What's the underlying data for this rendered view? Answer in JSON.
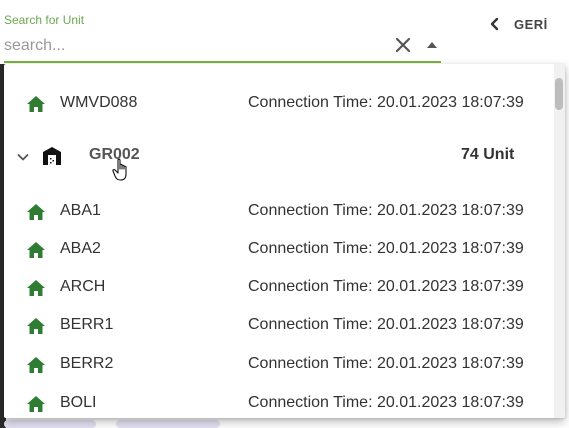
{
  "search": {
    "label": "Search for Unit",
    "placeholder": "search...",
    "value": ""
  },
  "nav": {
    "back_label": "GERİ"
  },
  "colors": {
    "accent": "#7cb342",
    "online_icon": "#2e7d32"
  },
  "icons": {
    "clear": "close-icon",
    "toggle": "triangle-up-icon",
    "back": "chevron-left-icon",
    "unit": "home-icon",
    "group": "building-icon",
    "expand": "chevron-down-icon"
  },
  "units_before": [
    {
      "name": "WMVD088",
      "connection": "Connection Time: 20.01.2023 18:07:39"
    }
  ],
  "group": {
    "name": "GR002",
    "count_label": "74 Unit",
    "expanded": true
  },
  "units": [
    {
      "name": "ABA1",
      "connection": "Connection Time: 20.01.2023 18:07:39"
    },
    {
      "name": "ABA2",
      "connection": "Connection Time: 20.01.2023 18:07:39"
    },
    {
      "name": "ARCH",
      "connection": "Connection Time: 20.01.2023 18:07:39"
    },
    {
      "name": "BERR1",
      "connection": "Connection Time: 20.01.2023 18:07:39"
    },
    {
      "name": "BERR2",
      "connection": "Connection Time: 20.01.2023 18:07:39"
    },
    {
      "name": "BOLI",
      "connection": "Connection Time: 20.01.2023 18:07:39"
    }
  ]
}
